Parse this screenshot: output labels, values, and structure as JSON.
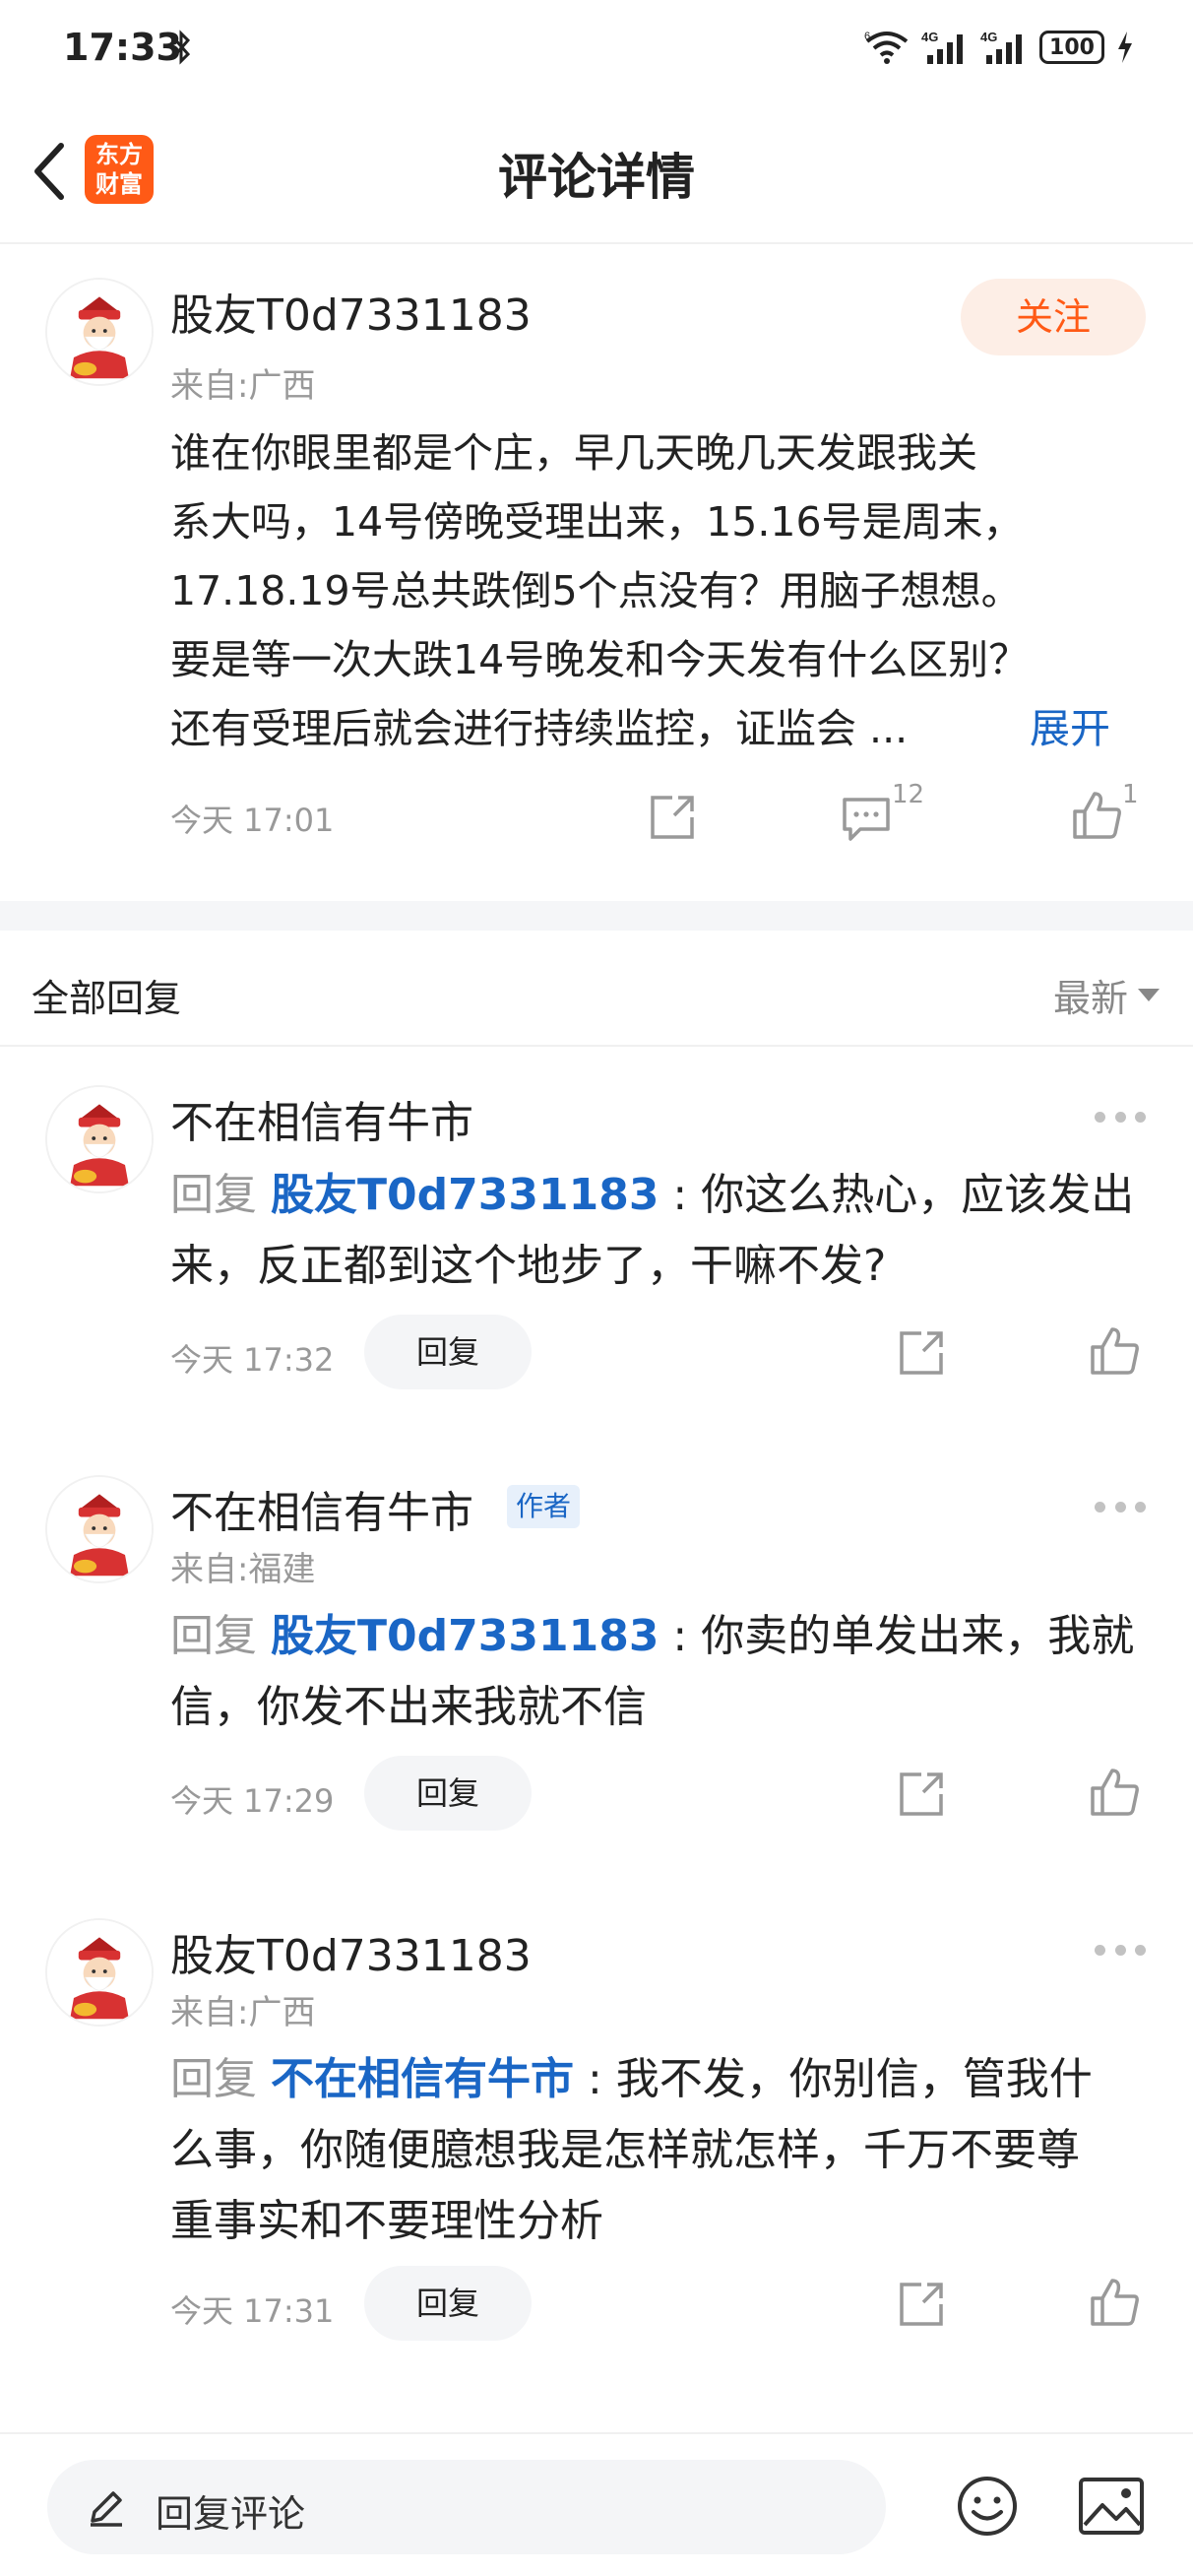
{
  "status_bar": {
    "time": "17:33",
    "battery": "100",
    "network_a": "4G",
    "network_b": "4G",
    "wifi_label": "6"
  },
  "nav": {
    "title": "评论详情",
    "logo_line1": "东方",
    "logo_line2": "财富"
  },
  "main_comment": {
    "username": "股友T0d7331183",
    "location": "来自:广西",
    "follow_label": "关注",
    "lines": [
      "谁在你眼里都是个庄，早几天晚几天发跟我关",
      "系大吗，14号傍晚受理出来，15.16号是周末，",
      "17.18.19号总共跌倒5个点没有？用脑子想想。",
      "要是等一次大跌14号晚发和今天发有什么区别？",
      "还有受理后就会进行持续监控，证监会 ..."
    ],
    "expand_label": "展开",
    "time": "今天 17:01",
    "comment_count": "12",
    "like_count": "1"
  },
  "replies_section": {
    "title": "全部回复",
    "sort_label": "最新"
  },
  "replies": [
    {
      "username": "不在相信有牛市",
      "location": "",
      "author_tag": "",
      "reply_prefix": "回复",
      "reply_target": "股友T0d7331183",
      "colon": " : ",
      "text_line1": "你这么热心，应该发出",
      "text_line2": "来，反正都到这个地步了，干嘛不发?",
      "text_line3": "",
      "time": "今天 17:32",
      "reply_btn": "回复"
    },
    {
      "username": "不在相信有牛市",
      "location": "来自:福建",
      "author_tag": "作者",
      "reply_prefix": "回复",
      "reply_target": "股友T0d7331183",
      "colon": " : ",
      "text_line1": "你卖的单发出来，我就",
      "text_line2": "信，你发不出来我就不信",
      "text_line3": "",
      "time": "今天 17:29",
      "reply_btn": "回复"
    },
    {
      "username": "股友T0d7331183",
      "location": "来自:广西",
      "author_tag": "",
      "reply_prefix": "回复",
      "reply_target": "不在相信有牛市",
      "colon": " : ",
      "text_line1": "我不发，你别信，管我什",
      "text_line2": "么事，你随便臆想我是怎样就怎样，千万不要尊",
      "text_line3": "重事实和不要理性分析",
      "time": "今天 17:31",
      "reply_btn": "回复"
    }
  ],
  "bottom_bar": {
    "placeholder": "回复评论"
  },
  "colors": {
    "accent": "#ff5a16",
    "link": "#1a66c5",
    "muted": "#999999"
  },
  "icons": [
    "bluetooth-icon",
    "wifi-icon",
    "signal-icon",
    "battery-icon",
    "back-icon",
    "share-icon",
    "comment-icon",
    "like-icon",
    "more-icon",
    "pencil-icon",
    "emoji-icon",
    "image-icon",
    "caishen-avatar"
  ]
}
